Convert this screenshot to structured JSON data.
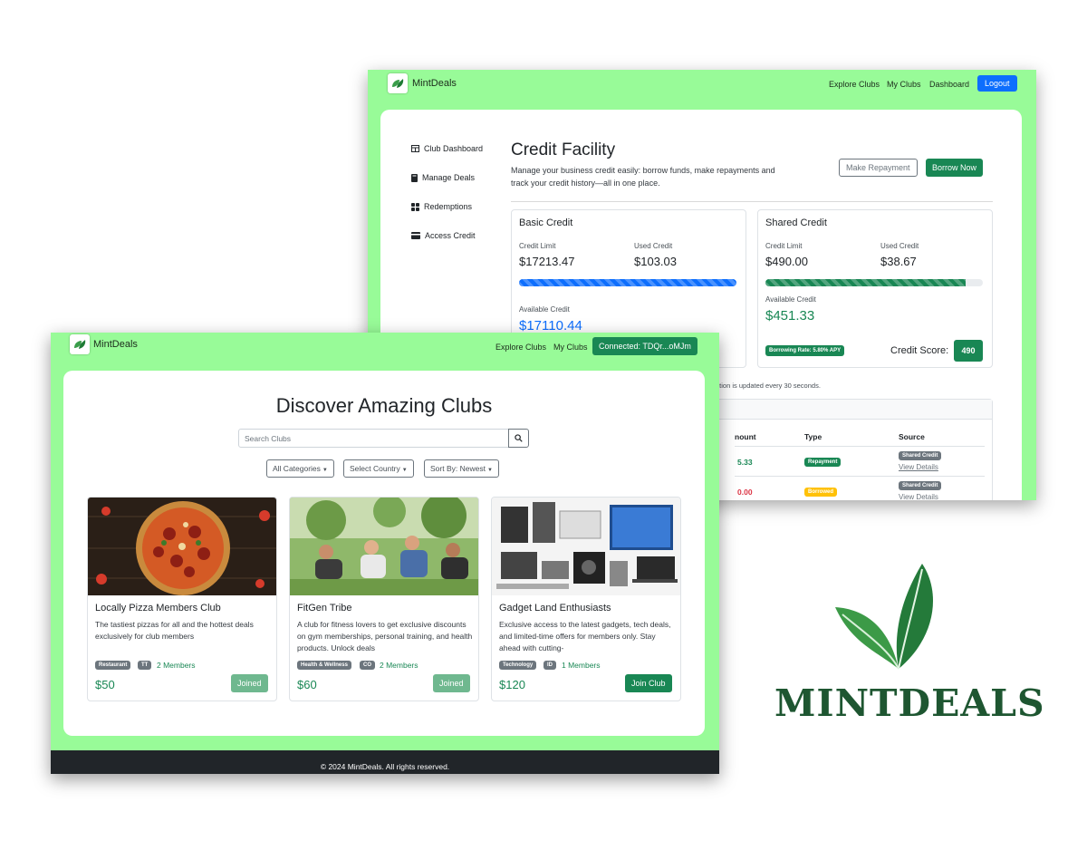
{
  "colors": {
    "mint_bg": "#98fb98",
    "green": "#198754",
    "blue": "#0d6efd",
    "red": "#dc3545",
    "yellow": "#ffc107",
    "gray": "#6c757d",
    "wordmark": "#1e5631"
  },
  "credit_window": {
    "brand": "MintDeals",
    "nav": {
      "explore": "Explore Clubs",
      "my_clubs": "My Clubs",
      "dashboard": "Dashboard",
      "logout": "Logout"
    },
    "sidebar": [
      {
        "label": "Club Dashboard",
        "icon": "table-icon"
      },
      {
        "label": "Manage Deals",
        "icon": "book-icon"
      },
      {
        "label": "Redemptions",
        "icon": "grid-icon"
      },
      {
        "label": "Access Credit",
        "icon": "credit-card-icon"
      }
    ],
    "title": "Credit Facility",
    "description": "Manage your business credit easily: borrow funds, make repayments and track your credit history—all in one place.",
    "make_repayment": "Make Repayment",
    "borrow_now": "Borrow Now",
    "basic": {
      "title": "Basic Credit",
      "limit_label": "Credit Limit",
      "limit": "$17213.47",
      "used_label": "Used Credit",
      "used": "$103.03",
      "progress_fraction": 1.0,
      "available_label": "Available Credit",
      "available": "$17110.44"
    },
    "shared": {
      "title": "Shared Credit",
      "limit_label": "Credit Limit",
      "limit": "$490.00",
      "used_label": "Used Credit",
      "used": "$38.67",
      "progress_fraction": 0.92,
      "available_label": "Available Credit",
      "available": "$451.33",
      "rate": "Borrowing Rate: 5.80% APY",
      "score_label": "Credit Score:",
      "score": "490"
    },
    "auto_note": "ation is updated every 30 seconds.",
    "table": {
      "headers": {
        "amount": "nount",
        "type": "Type",
        "source": "Source"
      },
      "rows": [
        {
          "amount": "5.33",
          "type": "Repayment",
          "source": "Shared Credit",
          "link": "View Details"
        },
        {
          "amount": "0.00",
          "type": "Borrowed",
          "source": "Shared Credit",
          "link": "View Details"
        }
      ]
    }
  },
  "clubs_window": {
    "brand": "MintDeals",
    "nav": {
      "explore": "Explore Clubs",
      "my_clubs": "My Clubs",
      "connected": "Connected: TDQr...oMJm"
    },
    "title": "Discover Amazing Clubs",
    "search": {
      "placeholder": "Search Clubs",
      "icon": "search-icon"
    },
    "filters": {
      "categories": "All Categories",
      "country": "Select Country",
      "sort": "Sort By: Newest"
    },
    "clubs": [
      {
        "name": "Locally Pizza Members Club",
        "description": "The tastiest pizzas for all and the hottest deals exclusively for club members",
        "category": "Restaurant",
        "country": "TT",
        "members": "2 Members",
        "price": "$50",
        "action": "Joined"
      },
      {
        "name": "FitGen Tribe",
        "description": "A club for fitness lovers to get exclusive discounts on gym memberships, personal training, and health products. Unlock deals",
        "category": "Health & Wellness",
        "country": "CO",
        "members": "2 Members",
        "price": "$60",
        "action": "Joined"
      },
      {
        "name": "Gadget Land Enthusiasts",
        "description": "Exclusive access to the latest gadgets, tech deals, and limited-time offers for members only. Stay ahead with cutting-",
        "category": "Technology",
        "country": "ID",
        "members": "1 Members",
        "price": "$120",
        "action": "Join Club"
      }
    ],
    "footer": "© 2024 MintDeals. All rights reserved."
  },
  "wordmark": "MINTDEALS"
}
